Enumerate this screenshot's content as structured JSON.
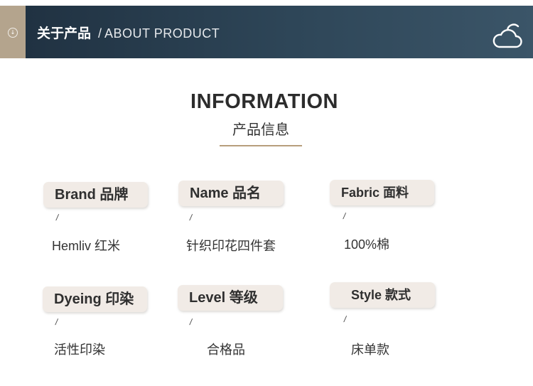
{
  "header": {
    "title_cn": "关于产品",
    "separator": "/",
    "title_en": "ABOUT PRODUCT",
    "tab_icon": "arrow-down-circle-icon",
    "right_icon": "cloud-icon"
  },
  "info": {
    "title": "INFORMATION",
    "subtitle": "产品信息"
  },
  "items": [
    {
      "label": "Brand 品牌",
      "slash": "/",
      "value": "Hemliv 红米"
    },
    {
      "label": "Name  品名",
      "slash": "/",
      "value": "针织印花四件套"
    },
    {
      "label": "Fabric 面料",
      "slash": "/",
      "value": "100%棉"
    },
    {
      "label": "Dyeing 印染",
      "slash": "/",
      "value": "活性印染"
    },
    {
      "label": "Level 等级",
      "slash": "/",
      "value": "合格品"
    },
    {
      "label": "Style 款式",
      "slash": "/",
      "value": "床单款"
    }
  ],
  "colors": {
    "header_bg": "#2e4658",
    "tab_bg": "#b4a48d",
    "accent_line": "#b79e7c",
    "pill_bg": "#f1ebe6"
  }
}
